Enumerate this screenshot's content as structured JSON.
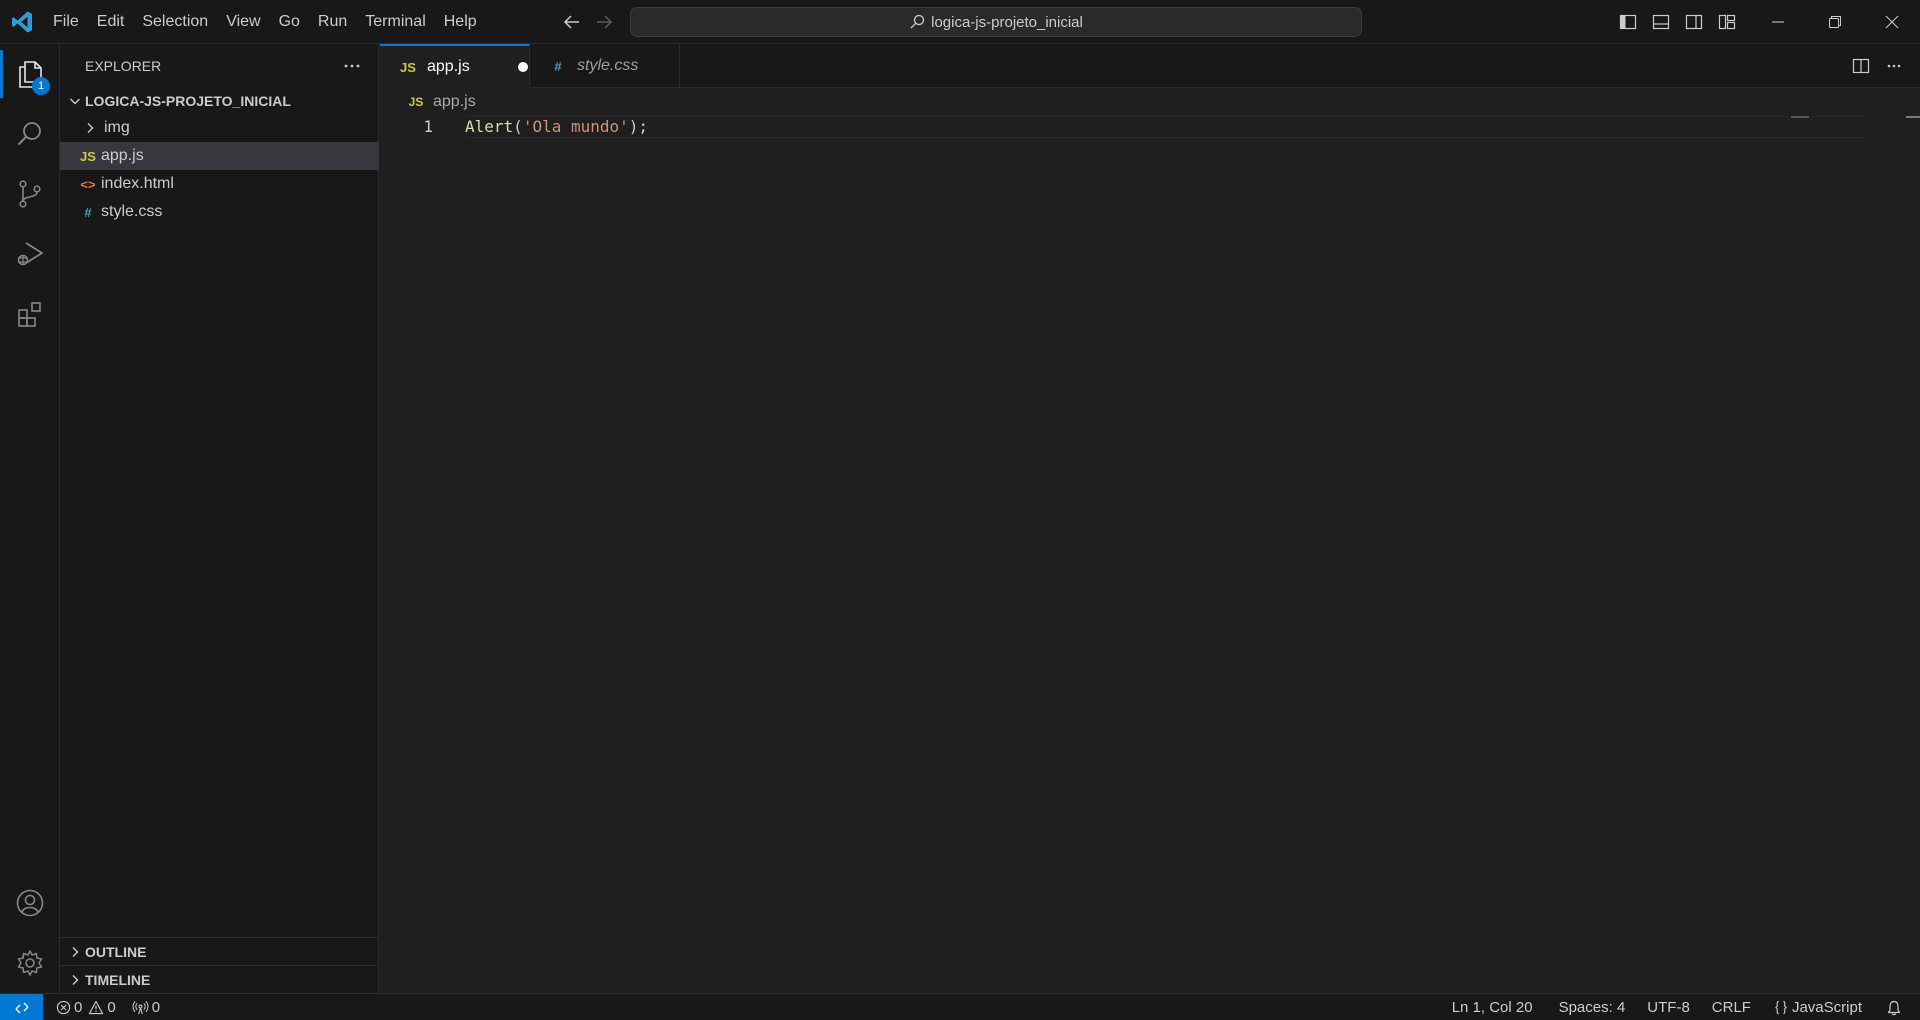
{
  "colors": {
    "accent": "#0078d4",
    "js_icon": "#cbcb41",
    "html_icon": "#e37933",
    "css_icon": "#519aba"
  },
  "titlebar": {
    "menu": [
      "File",
      "Edit",
      "Selection",
      "View",
      "Go",
      "Run",
      "Terminal",
      "Help"
    ],
    "command_center": "logica-js-projeto_inicial",
    "icons": [
      "toggle-sidebar-icon",
      "toggle-panel-icon",
      "toggle-secondary-sidebar-icon",
      "customize-layout-icon"
    ]
  },
  "activitybar": {
    "explorer_badge": "1"
  },
  "sidebar": {
    "title": "EXPLORER",
    "folder": "LOGICA-JS-PROJETO_INICIAL",
    "items": [
      {
        "label": "img",
        "icon_text": ""
      },
      {
        "label": "app.js",
        "icon_text": "JS"
      },
      {
        "label": "index.html",
        "icon_text": "<>"
      },
      {
        "label": "style.css",
        "icon_text": "#"
      }
    ],
    "outline": "OUTLINE",
    "timeline": "TIMELINE"
  },
  "tabs": [
    {
      "label": "app.js",
      "icon_text": "JS"
    },
    {
      "label": "style.css",
      "icon_text": "#"
    }
  ],
  "breadcrumb": {
    "icon_text": "JS",
    "file": "app.js"
  },
  "editor": {
    "line_number": "1",
    "tokens": {
      "fn": "Alert",
      "open": "(",
      "str": "'Ola mundo'",
      "close": ");"
    }
  },
  "statusbar": {
    "errors": "0",
    "warnings": "0",
    "ports": "0",
    "position": "Ln 1, Col 20",
    "spaces": "Spaces: 4",
    "encoding": "UTF-8",
    "eol": "CRLF",
    "language": "JavaScript"
  }
}
